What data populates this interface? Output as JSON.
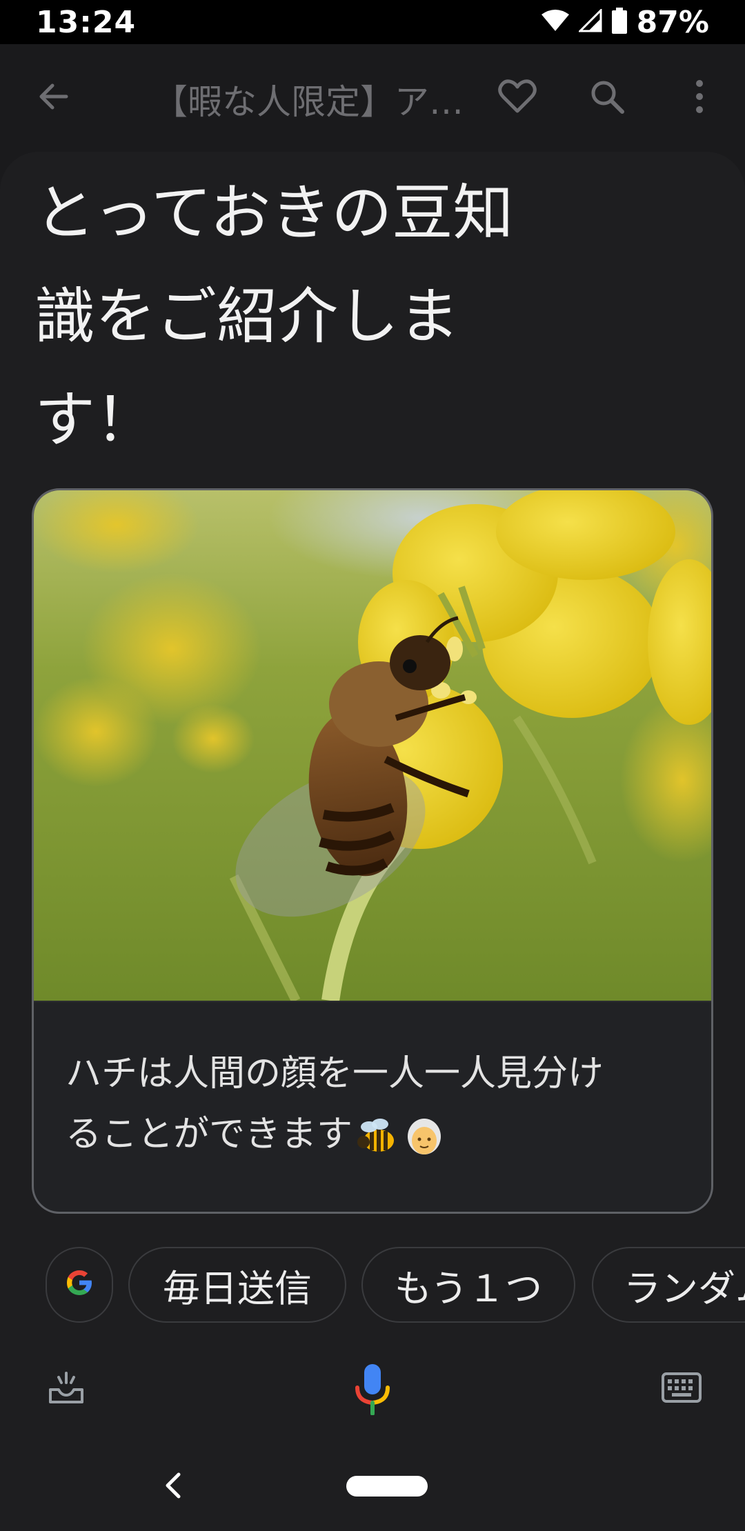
{
  "status_bar": {
    "time": "13:24",
    "battery": "87%",
    "icons": [
      "wifi-icon",
      "signal-icon",
      "battery-icon"
    ]
  },
  "app_bar": {
    "title": "【暇な人限定】ア…",
    "icons": [
      "back-arrow-icon",
      "heart-icon",
      "search-icon",
      "more-vert-icon"
    ]
  },
  "headline": {
    "line1": "とっておきの豆知",
    "line2": "識をご紹介しま",
    "line3": "す！"
  },
  "card": {
    "image_label": "bee-on-rapeseed-flower",
    "text_line1": "ハチは人間の顔を一人一人見分け",
    "text_line2": "ることができます",
    "emojis": [
      "bee-emoji",
      "older-person-emoji"
    ]
  },
  "chips": [
    {
      "label": ""
    },
    {
      "label": "毎日送信"
    },
    {
      "label": "もう１つ"
    },
    {
      "label": "ランダム"
    }
  ],
  "input_bar": {
    "icons": [
      "inbox-icon",
      "microphone-icon",
      "keyboard-icon"
    ]
  },
  "colors": {
    "background": "#1e1e20",
    "status_bar": "#000000",
    "title_gray": "#6e6e72",
    "card_border": "#5f6166",
    "mic_blue": "#4285f4",
    "mic_red": "#ea4335",
    "mic_yellow": "#fbbc05",
    "mic_green": "#34a853"
  }
}
